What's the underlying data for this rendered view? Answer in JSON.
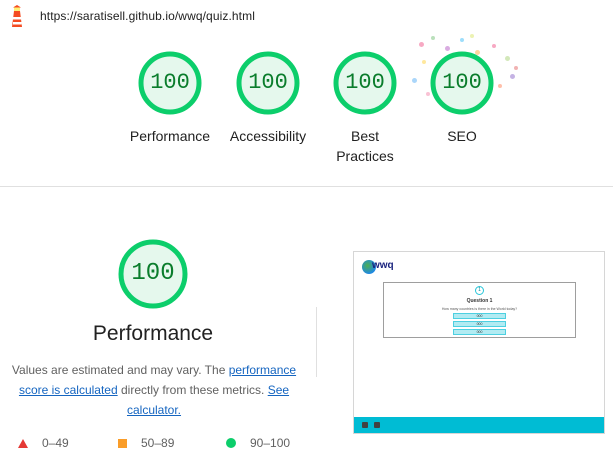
{
  "topbar": {
    "url": "https://saratisell.github.io/wwq/quiz.html",
    "logo_icon": "lighthouse-icon"
  },
  "summary_scores": [
    {
      "score": "100",
      "label": "Performance"
    },
    {
      "score": "100",
      "label": "Accessibility"
    },
    {
      "score": "100",
      "label": "Best Practices",
      "label_line1": "Best",
      "label_line2": "Practices"
    },
    {
      "score": "100",
      "label": "SEO"
    }
  ],
  "performance": {
    "score": "100",
    "title": "Performance",
    "desc_prefix": "Values are estimated and may vary. The ",
    "link_score": "performance score is calculated",
    "desc_middle": " directly from these metrics. ",
    "link_calc": "See calculator.",
    "legend": [
      {
        "shape": "triangle",
        "range": "0–49",
        "color": "#e53935"
      },
      {
        "shape": "square",
        "range": "50–89",
        "color": "#fa9d29"
      },
      {
        "shape": "circle",
        "range": "90–100",
        "color": "#0cce6b"
      }
    ]
  },
  "screenshot": {
    "logo_text": "wwq",
    "badge": "1",
    "question_title": "Question 1",
    "question_text": "How many countries is there in the World today?",
    "options": [
      "000",
      "000",
      "000"
    ]
  },
  "colors": {
    "pass": "#0cce6b",
    "pass_text": "#0a7d2c",
    "pass_fill": "#e5f8ed",
    "link": "#1565c0",
    "footer": "#00bcd4"
  }
}
